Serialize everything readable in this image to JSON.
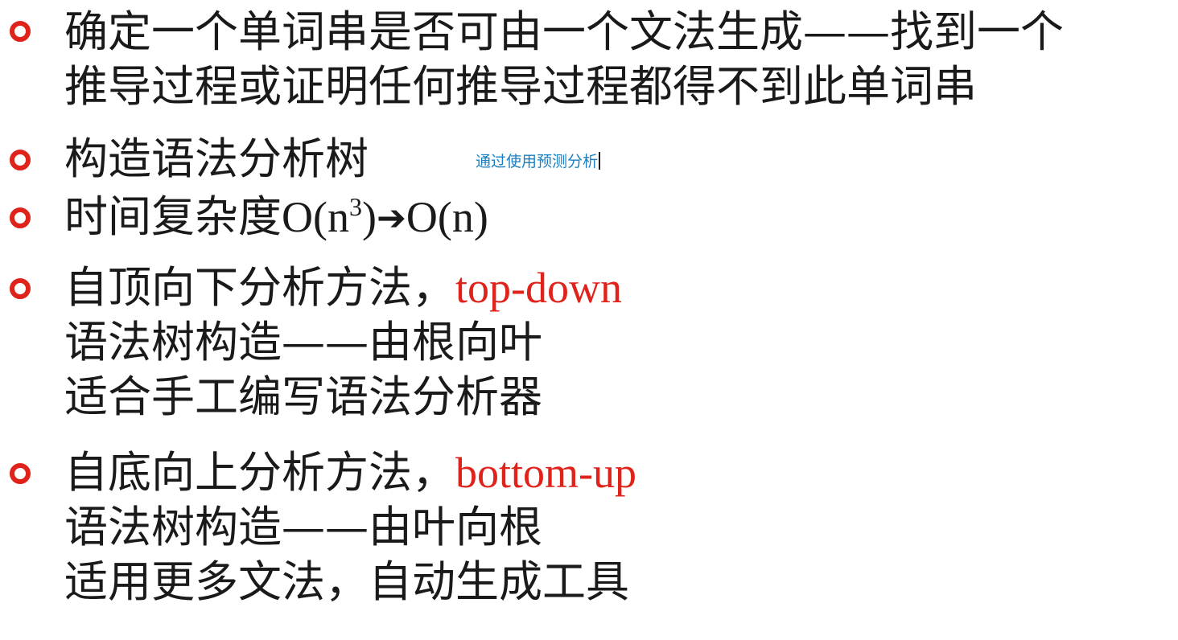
{
  "slide": {
    "bullets": [
      {
        "lines": [
          "确定一个单词串是否可由一个文法生成——找到一个",
          "推导过程或证明任何推导过程都得不到此单词串"
        ]
      },
      {
        "lines": [
          "构造语法分析树"
        ],
        "annotation": "通过使用预测分析"
      },
      {
        "prefix": "时间复杂度",
        "expr_left": "O(n",
        "sup": "3",
        "expr_mid": ")",
        "arrow": "➔",
        "expr_right": "O(n)"
      },
      {
        "head": "自顶向下分析方法，",
        "head_term": "top-down",
        "lines": [
          "语法树构造——由根向叶",
          "适合手工编写语法分析器"
        ]
      },
      {
        "head": "自底向上分析方法，",
        "head_term": "bottom-up",
        "lines": [
          "语法树构造——由叶向根",
          "适用更多文法，自动生成工具"
        ]
      }
    ]
  },
  "colors": {
    "accent": "#e0231a",
    "annotation": "#1a7fc1",
    "text": "#1a1a1a"
  },
  "icons": {
    "bullet": "hollow-circle-bullet-icon",
    "arrow": "right-arrow-icon"
  }
}
